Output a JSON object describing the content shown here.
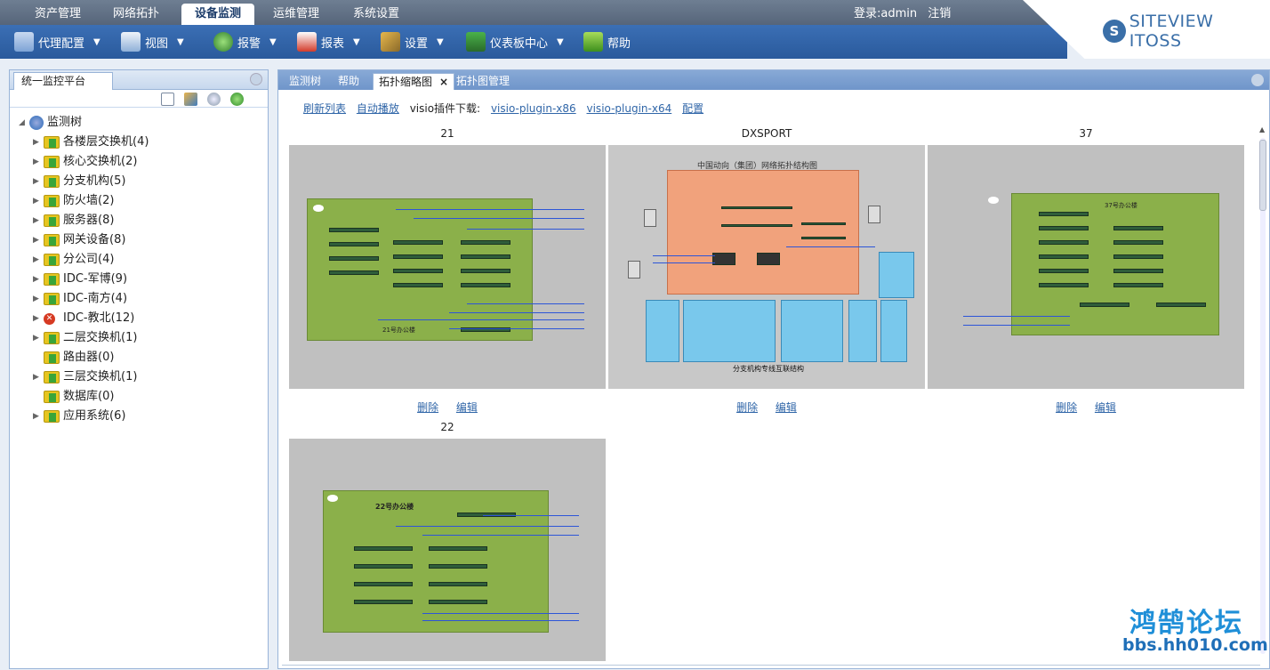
{
  "top_tabs": [
    "资产管理",
    "网络拓扑",
    "设备监测",
    "运维管理",
    "系统设置"
  ],
  "active_top_tab": "设备监测",
  "login": {
    "text": "登录:admin",
    "logout": "注销"
  },
  "logo": {
    "mark": "S",
    "text": "SITEVIEW ITOSS"
  },
  "toolbar": [
    {
      "label": "代理配置",
      "icon": "agent-config-icon"
    },
    {
      "label": "视图",
      "icon": "view-icon"
    },
    {
      "label": "报警",
      "icon": "alarm-icon"
    },
    {
      "label": "报表",
      "icon": "report-icon"
    },
    {
      "label": "设置",
      "icon": "settings-icon"
    },
    {
      "label": "仪表板中心",
      "icon": "dashboard-icon"
    },
    {
      "label": "帮助",
      "icon": "help-icon"
    }
  ],
  "left_panel": {
    "tab": "统一监控平台",
    "root": "监测树",
    "nodes": [
      {
        "label": "各楼层交换机(4)",
        "expandable": true,
        "status": "ok"
      },
      {
        "label": "核心交换机(2)",
        "expandable": true,
        "status": "ok"
      },
      {
        "label": "分支机构(5)",
        "expandable": true,
        "status": "ok"
      },
      {
        "label": "防火墙(2)",
        "expandable": true,
        "status": "ok"
      },
      {
        "label": "服务器(8)",
        "expandable": true,
        "status": "ok"
      },
      {
        "label": "网关设备(8)",
        "expandable": true,
        "status": "ok"
      },
      {
        "label": "分公司(4)",
        "expandable": true,
        "status": "ok"
      },
      {
        "label": "IDC-军博(9)",
        "expandable": true,
        "status": "ok"
      },
      {
        "label": "IDC-南方(4)",
        "expandable": true,
        "status": "ok"
      },
      {
        "label": "IDC-教北(12)",
        "expandable": true,
        "status": "error"
      },
      {
        "label": "二层交换机(1)",
        "expandable": true,
        "status": "ok"
      },
      {
        "label": "路由器(0)",
        "expandable": false,
        "status": "ok"
      },
      {
        "label": "三层交换机(1)",
        "expandable": true,
        "status": "ok"
      },
      {
        "label": "数据库(0)",
        "expandable": false,
        "status": "ok"
      },
      {
        "label": "应用系统(6)",
        "expandable": true,
        "status": "ok"
      }
    ]
  },
  "right_panel": {
    "tabs": [
      "监测树",
      "帮助",
      "拓扑缩略图",
      "拓扑图管理"
    ],
    "active_tab": "拓扑缩略图",
    "links": {
      "refresh": "刷新列表",
      "autoplay": "自动播放",
      "download_label": "visio插件下载:",
      "x86": "visio-plugin-x86",
      "x64": "visio-plugin-x64",
      "config": "配置"
    },
    "thumbnails": [
      {
        "title": "21",
        "inner_label": "21号办公楼",
        "delete": "删除",
        "edit": "编辑"
      },
      {
        "title": "DXSPORT",
        "inner_label": "中国动向（集团）网络拓扑结构图",
        "inner_sub": "分支机构专线互联结构",
        "delete": "删除",
        "edit": "编辑"
      },
      {
        "title": "37",
        "inner_label": "37号办公楼",
        "delete": "删除",
        "edit": "编辑"
      },
      {
        "title": "22",
        "inner_label": "22号办公楼",
        "delete": "",
        "edit": ""
      }
    ]
  },
  "watermark": {
    "line1": "鸿鹄论坛",
    "line2": "bbs.hh010.com"
  }
}
